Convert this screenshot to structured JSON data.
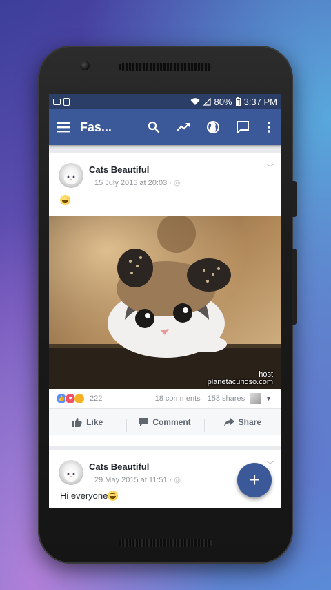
{
  "status_bar": {
    "battery": "80%",
    "time": "3:37 PM"
  },
  "toolbar": {
    "title": "Fas..."
  },
  "icons": {
    "menu": "menu-icon",
    "search": "search-icon",
    "trending": "trending-icon",
    "globe": "globe-icon",
    "messages": "message-icon",
    "more": "more-vert-icon"
  },
  "colors": {
    "brand": "#3b5998",
    "status_bar": "#2b3e68"
  },
  "posts": [
    {
      "page_name": "Cats Beautiful",
      "date": "15 July 2015 at 20:03 · ",
      "reactions_count": "222",
      "comments": "18 comments",
      "shares": "158 shares",
      "image_watermark_1": "host",
      "image_watermark_2": "planetacurioso.com"
    },
    {
      "page_name": "Cats Beautiful",
      "date": "29 May 2015 at 11:51 · ",
      "text": "Hi everyone"
    }
  ],
  "actions": {
    "like": "Like",
    "comment": "Comment",
    "share": "Share"
  },
  "fab_label": "+"
}
